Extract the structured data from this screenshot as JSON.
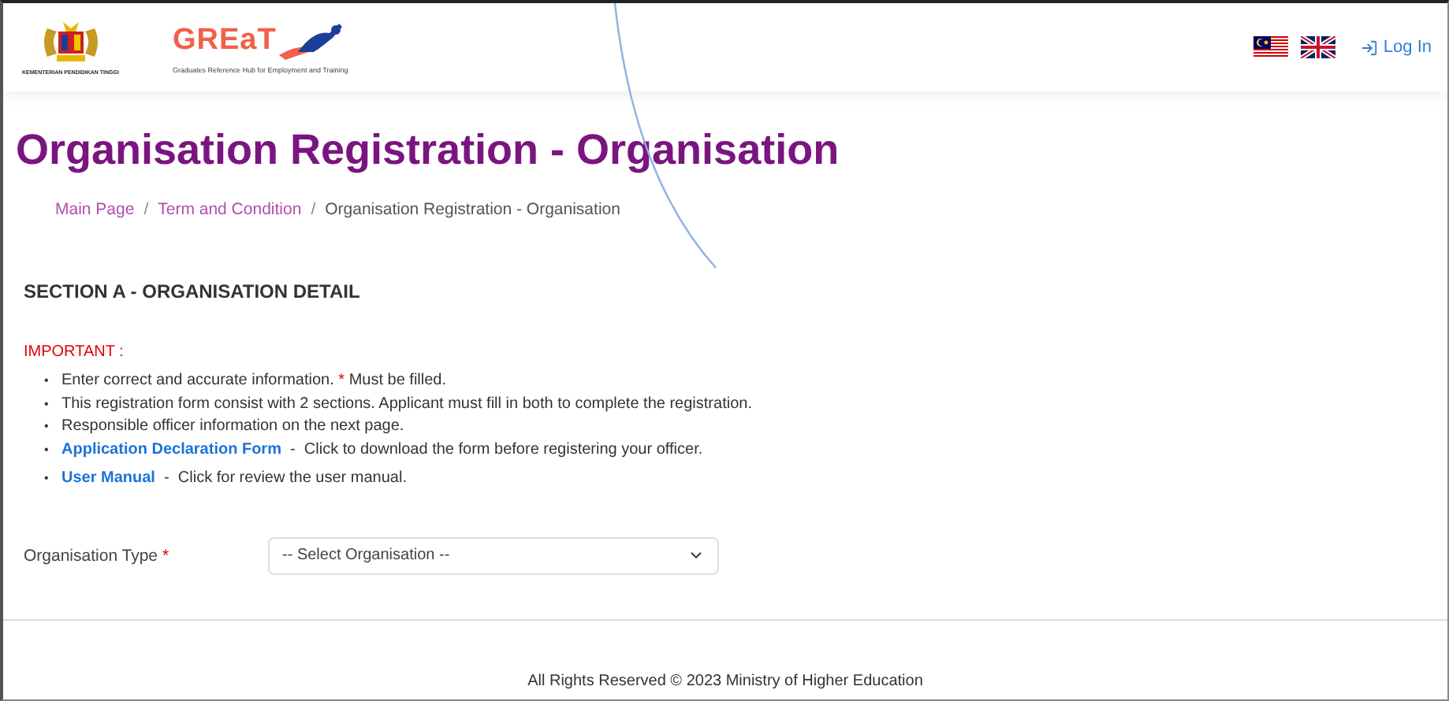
{
  "header": {
    "ministry_caption": "KEMENTERIAN PENDIDIKAN TINGGI",
    "brand": "GREaT",
    "brand_tagline": "Graduates Reference Hub for Employment and Training",
    "languages": [
      {
        "kind": "malaysia"
      },
      {
        "kind": "uk"
      }
    ],
    "login": "Log In"
  },
  "page_title": "Organisation Registration - Organisation",
  "breadcrumb_separator": "/",
  "bullet": "•",
  "breadcrumb": [
    {
      "label": "Main Page",
      "link": true
    },
    {
      "label": "Term and Condition",
      "link": true
    },
    {
      "label": "Organisation Registration - Organisation",
      "link": false
    }
  ],
  "section_title": "SECTION A - ORGANISATION DETAIL",
  "important_label": "IMPORTANT :",
  "notes": [
    {
      "segments": [
        {
          "kind": "text",
          "text": "Enter correct and accurate information. "
        },
        {
          "kind": "mark",
          "text": "*"
        },
        {
          "kind": "text",
          "text": " Must be filled."
        }
      ]
    },
    {
      "segments": [
        {
          "kind": "text",
          "text": "This registration form consist with 2 sections. Applicant must fill in both to complete the registration."
        }
      ]
    },
    {
      "segments": [
        {
          "kind": "text",
          "text": "Responsible officer information on the next page."
        }
      ]
    },
    {
      "segments": [
        {
          "kind": "link",
          "text": "Application Declaration Form"
        },
        {
          "kind": "text",
          "text": "  -  Click to download the form before registering your officer."
        }
      ]
    },
    {
      "segments": [
        {
          "kind": "link",
          "text": "User Manual"
        },
        {
          "kind": "text",
          "text": "  -  Click for review the user manual."
        }
      ]
    }
  ],
  "form": {
    "label": "Organisation Type",
    "required_mark": "*",
    "placeholder": "-- Select Organisation --"
  },
  "footer": "All Rights Reserved © 2023 Ministry of Higher Education"
}
